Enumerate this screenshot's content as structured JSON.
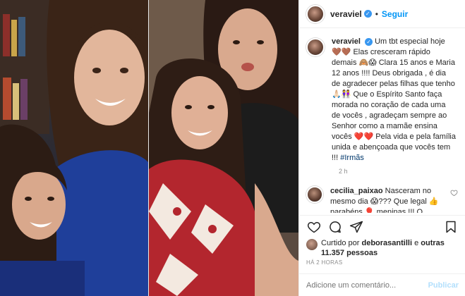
{
  "post": {
    "username": "veraviel",
    "follow_label": "Seguir",
    "separator": "•",
    "caption": {
      "text": "Um tbt especial hoje 🤎🤎 Elas cresceram rápido demais 🙈😱 Clara 15 anos e Maria 12 anos !!!! Deus obrigada , é dia de agradecer pelas filhas que tenho 🙏🏻👭 Que o Espírito Santo faça morada no coração de cada uma de vocês , agradeçam sempre ao Senhor como a mamãe ensina vocês ❤️❤️ Pela vida e pela família unida e abençoada que vocês tem !!! ",
      "hashtag": "#Irmãs",
      "time": "2 h"
    },
    "comments": [
      {
        "username": "cecilia_paixao",
        "text": "Nasceram no mesmo dia 😱??? Que legal 👍 parabéns 🎈 meninas !!! O melhor de tudo é que vcs tem uma a outra para sempre"
      }
    ],
    "likes": {
      "prefix": "Curtido por",
      "user": "deborasantilli",
      "connector": "e",
      "others": "outras 11.357 pessoas"
    },
    "time_ago": "HÁ 2 HORAS",
    "add_comment_placeholder": "Adicione um comentário...",
    "publish_label": "Publicar"
  },
  "icons": {
    "verified": "verified-badge-icon",
    "like": "heart-icon",
    "comment": "comment-icon",
    "share": "share-icon",
    "save": "bookmark-icon",
    "comment_like": "small-heart-icon"
  },
  "colors": {
    "link": "#0095f6",
    "verified": "#3897f0",
    "muted": "#8e8e8e",
    "publish_disabled": "#b2dffc",
    "hashtag": "#00376b"
  }
}
